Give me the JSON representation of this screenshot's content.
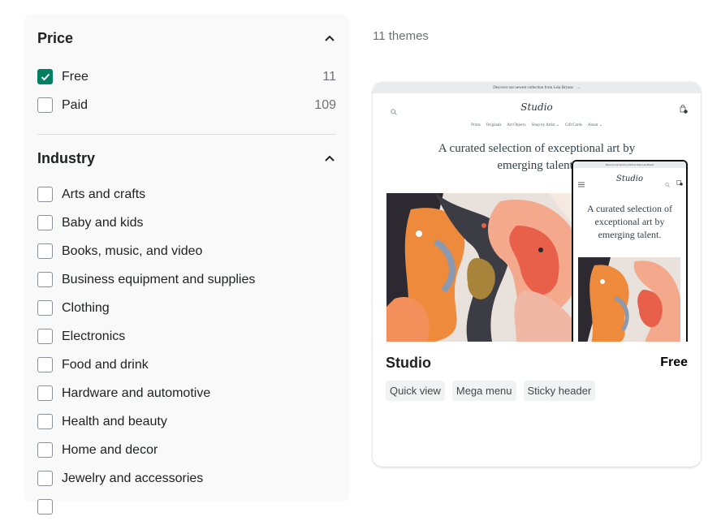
{
  "filters": {
    "price": {
      "title": "Price",
      "options": [
        {
          "label": "Free",
          "count": "11",
          "checked": true
        },
        {
          "label": "Paid",
          "count": "109",
          "checked": false
        }
      ]
    },
    "industry": {
      "title": "Industry",
      "options": [
        {
          "label": "Arts and crafts"
        },
        {
          "label": "Baby and kids"
        },
        {
          "label": "Books, music, and video"
        },
        {
          "label": "Business equipment and supplies"
        },
        {
          "label": "Clothing"
        },
        {
          "label": "Electronics"
        },
        {
          "label": "Food and drink"
        },
        {
          "label": "Hardware and automotive"
        },
        {
          "label": "Health and beauty"
        },
        {
          "label": "Home and decor"
        },
        {
          "label": "Jewelry and accessories"
        }
      ]
    }
  },
  "results": {
    "count_label": "11 themes"
  },
  "theme_card": {
    "name": "Studio",
    "price": "Free",
    "tags": [
      "Quick view",
      "Mega menu",
      "Sticky header"
    ],
    "preview": {
      "announcement": "Discover our newest collection from Leia Bryans",
      "logo": "Studio",
      "nav": [
        "Prints",
        "Originals",
        "Art Objects",
        "Shop by Artist ⌄",
        "Gift Cards",
        "About ⌄"
      ],
      "hero_line1": "A curated selection of exceptional art by",
      "hero_line2": "emerging talent.",
      "mobile_hero": "A curated selection of exceptional art by emerging talent."
    }
  },
  "colors": {
    "accent": "#008060",
    "sidebar_bg": "#f9f9f9",
    "tag_bg": "#f1f2f3"
  }
}
